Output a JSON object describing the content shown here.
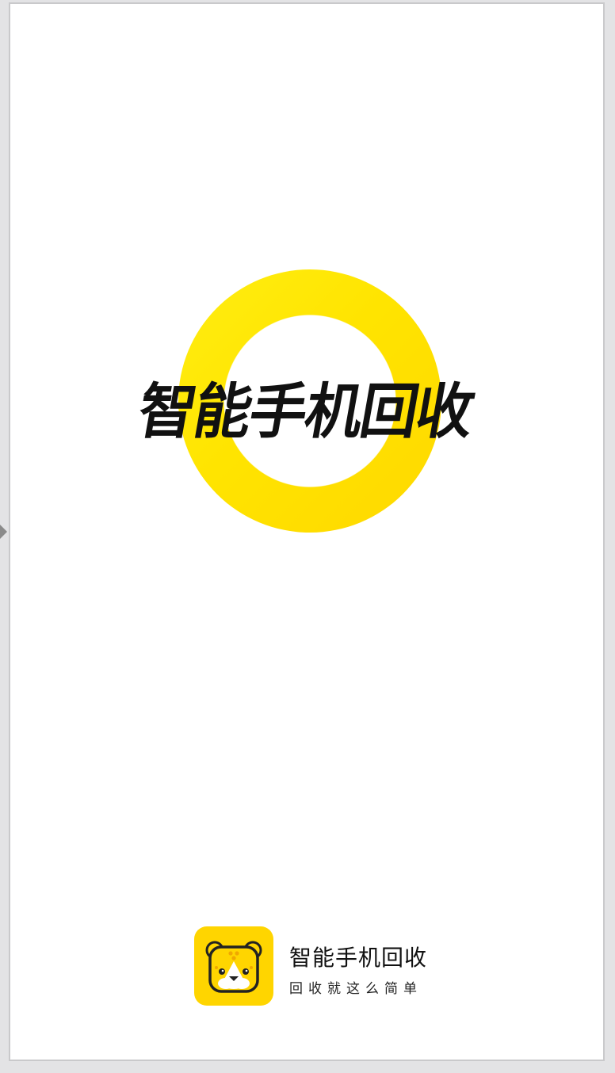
{
  "splash": {
    "title": "智能手机回收",
    "ring_color": "#FFE400",
    "background": "#FFFFFF"
  },
  "brand": {
    "logo_icon": "cartoon-tiger-icon",
    "name": "智能手机回收",
    "slogan": "回收就这么简单",
    "accent": "#FFD500"
  }
}
